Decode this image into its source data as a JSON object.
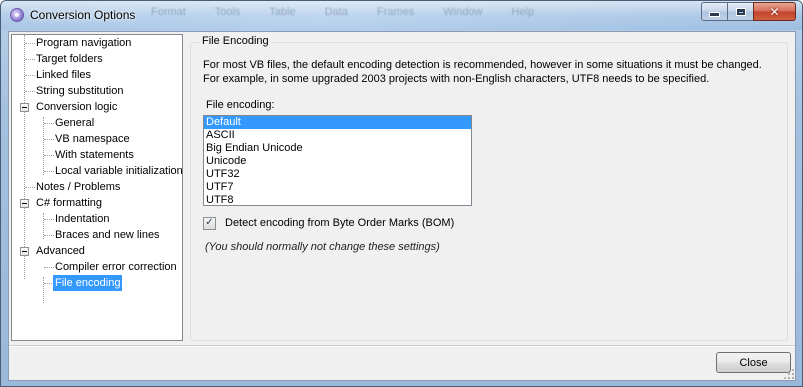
{
  "window": {
    "title": "Conversion Options",
    "background_menu": [
      "Format",
      "Tools",
      "Table",
      "Data",
      "Frames",
      "Window",
      "Help"
    ]
  },
  "tree": {
    "items": [
      {
        "label": "Program navigation",
        "level": 0,
        "selected": false
      },
      {
        "label": "Target folders",
        "level": 0,
        "selected": false
      },
      {
        "label": "Linked files",
        "level": 0,
        "selected": false
      },
      {
        "label": "String substitution",
        "level": 0,
        "selected": false
      },
      {
        "label": "Conversion logic",
        "level": 0,
        "expanded": true,
        "selected": false
      },
      {
        "label": "General",
        "level": 1,
        "selected": false
      },
      {
        "label": "VB namespace",
        "level": 1,
        "selected": false
      },
      {
        "label": "With statements",
        "level": 1,
        "selected": false
      },
      {
        "label": "Local variable initialization",
        "level": 1,
        "selected": false
      },
      {
        "label": "Notes / Problems",
        "level": 0,
        "selected": false
      },
      {
        "label": "C# formatting",
        "level": 0,
        "expanded": true,
        "selected": false
      },
      {
        "label": "Indentation",
        "level": 1,
        "selected": false
      },
      {
        "label": "Braces and new lines",
        "level": 1,
        "selected": false
      },
      {
        "label": "Advanced",
        "level": 0,
        "expanded": true,
        "selected": false
      },
      {
        "label": "Compiler error correction",
        "level": 1,
        "selected": false
      },
      {
        "label": "File encoding",
        "level": 1,
        "selected": true
      }
    ]
  },
  "panel": {
    "group_title": "File Encoding",
    "description_line1": "For most VB files, the default encoding detection is recommended, however in some situations it must be changed.",
    "description_line2": "For example, in some upgraded 2003 projects with non-English characters, UTF8 needs to be specified.",
    "encoding_label": "File encoding:",
    "encodings": [
      "Default",
      "ASCII",
      "Big Endian Unicode",
      "Unicode",
      "UTF32",
      "UTF7",
      "UTF8"
    ],
    "selected_encoding": "Default",
    "bom_checkbox_label": "Detect encoding from Byte Order Marks (BOM)",
    "bom_checked": true,
    "note": "(You should normally not change these settings)"
  },
  "footer": {
    "close_label": "Close"
  },
  "colors": {
    "selection": "#3399ff",
    "dialog_bg": "#f0f0f0"
  }
}
